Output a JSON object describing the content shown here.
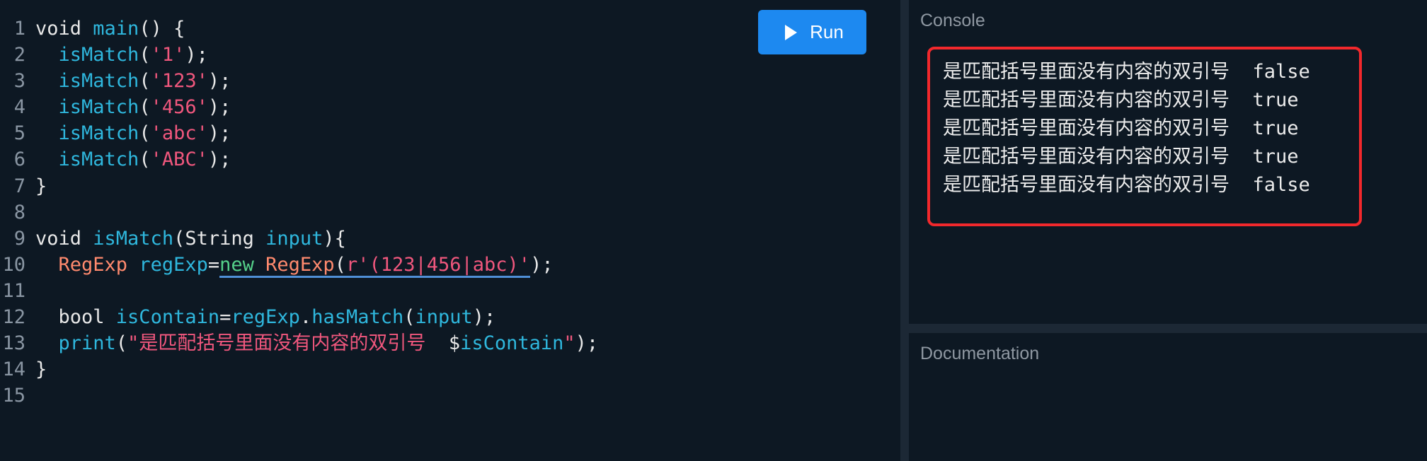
{
  "toolbar": {
    "run_label": "Run"
  },
  "code": {
    "lines": [
      {
        "n": "1",
        "tokens": [
          [
            "kw",
            "void "
          ],
          [
            "fn",
            "main"
          ],
          [
            "pun",
            "() {"
          ]
        ]
      },
      {
        "n": "2",
        "tokens": [
          [
            "pun",
            "  "
          ],
          [
            "fn",
            "isMatch"
          ],
          [
            "pun",
            "("
          ],
          [
            "str",
            "'1'"
          ],
          [
            "pun",
            ");"
          ]
        ]
      },
      {
        "n": "3",
        "tokens": [
          [
            "pun",
            "  "
          ],
          [
            "fn",
            "isMatch"
          ],
          [
            "pun",
            "("
          ],
          [
            "str",
            "'123'"
          ],
          [
            "pun",
            ");"
          ]
        ]
      },
      {
        "n": "4",
        "tokens": [
          [
            "pun",
            "  "
          ],
          [
            "fn",
            "isMatch"
          ],
          [
            "pun",
            "("
          ],
          [
            "str",
            "'456'"
          ],
          [
            "pun",
            ");"
          ]
        ]
      },
      {
        "n": "5",
        "tokens": [
          [
            "pun",
            "  "
          ],
          [
            "fn",
            "isMatch"
          ],
          [
            "pun",
            "("
          ],
          [
            "str",
            "'abc'"
          ],
          [
            "pun",
            ");"
          ]
        ]
      },
      {
        "n": "6",
        "tokens": [
          [
            "pun",
            "  "
          ],
          [
            "fn",
            "isMatch"
          ],
          [
            "pun",
            "("
          ],
          [
            "str",
            "'ABC'"
          ],
          [
            "pun",
            ");"
          ]
        ]
      },
      {
        "n": "7",
        "tokens": [
          [
            "pun",
            "}"
          ]
        ]
      },
      {
        "n": "8",
        "tokens": []
      },
      {
        "n": "9",
        "tokens": [
          [
            "kw",
            "void "
          ],
          [
            "fn",
            "isMatch"
          ],
          [
            "pun",
            "(String "
          ],
          [
            "fn",
            "input"
          ],
          [
            "pun",
            "){"
          ]
        ]
      },
      {
        "n": "10",
        "tokens": [
          [
            "pun",
            "  "
          ],
          [
            "type",
            "RegExp "
          ],
          [
            "fn",
            "regExp"
          ],
          [
            "pun",
            "="
          ],
          [
            "new",
            "new ",
            "u"
          ],
          [
            "type",
            "RegExp",
            "u"
          ],
          [
            "pun",
            "(",
            "u"
          ],
          [
            "str",
            "r'(123|456|abc)'",
            "u"
          ],
          [
            "pun",
            ");"
          ]
        ]
      },
      {
        "n": "11",
        "tokens": []
      },
      {
        "n": "12",
        "tokens": [
          [
            "pun",
            "  bool "
          ],
          [
            "fn",
            "isContain"
          ],
          [
            "pun",
            "="
          ],
          [
            "fn",
            "regExp"
          ],
          [
            "pun",
            "."
          ],
          [
            "fn",
            "hasMatch"
          ],
          [
            "pun",
            "("
          ],
          [
            "fn",
            "input"
          ],
          [
            "pun",
            ");"
          ]
        ]
      },
      {
        "n": "13",
        "tokens": [
          [
            "pun",
            "  "
          ],
          [
            "fn",
            "print"
          ],
          [
            "pun",
            "("
          ],
          [
            "str",
            "\"是匹配括号里面没有内容的双引号  "
          ],
          [
            "pun",
            "$"
          ],
          [
            "fn",
            "isContain"
          ],
          [
            "str",
            "\""
          ],
          [
            "pun",
            ");"
          ]
        ]
      },
      {
        "n": "14",
        "tokens": [
          [
            "pun",
            "}"
          ]
        ]
      },
      {
        "n": "15",
        "tokens": []
      }
    ]
  },
  "console": {
    "title": "Console",
    "output": [
      "是匹配括号里面没有内容的双引号  false",
      "是匹配括号里面没有内容的双引号  true",
      "是匹配括号里面没有内容的双引号  true",
      "是匹配括号里面没有内容的双引号  true",
      "是匹配括号里面没有内容的双引号  false"
    ]
  },
  "documentation": {
    "title": "Documentation"
  },
  "colors": {
    "background": "#0d1823",
    "run_button": "#1d89f0",
    "highlight_border": "#f2282c",
    "function": "#2fb7dd",
    "string": "#f0577d",
    "type": "#ff8a6e",
    "keyword_new": "#55d18a"
  },
  "icons": {
    "run": "play-icon"
  }
}
